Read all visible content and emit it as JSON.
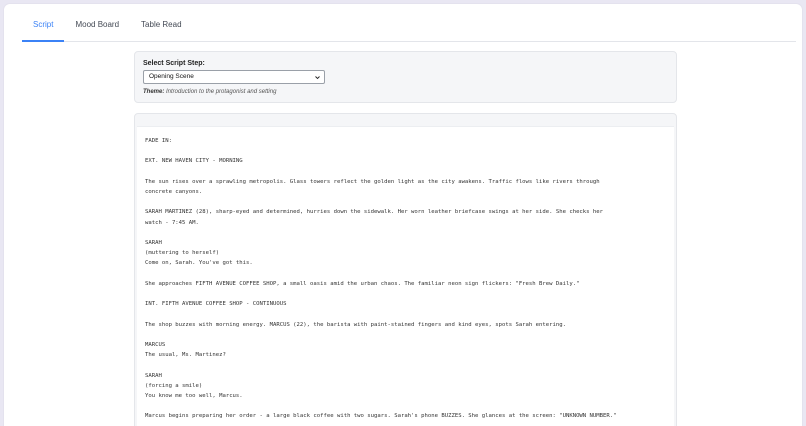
{
  "tabs": [
    {
      "label": "Script",
      "active": true
    },
    {
      "label": "Mood Board",
      "active": false
    },
    {
      "label": "Table Read",
      "active": false
    }
  ],
  "step_selector": {
    "label": "Select Script Step:",
    "selected": "Opening Scene",
    "theme_label": "Theme:",
    "theme_value": "Introduction to the protagonist and setting"
  },
  "script": {
    "lines": [
      "FADE IN:",
      "",
      "EXT. NEW HAVEN CITY - MORNING",
      "",
      "The sun rises over a sprawling metropolis. Glass towers reflect the golden light as the city awakens. Traffic flows like rivers through",
      "concrete canyons.",
      "",
      "SARAH MARTINEZ (28), sharp-eyed and determined, hurries down the sidewalk. Her worn leather briefcase swings at her side. She checks her",
      "watch - 7:45 AM.",
      "",
      "SARAH",
      "(muttering to herself)",
      "Come on, Sarah. You've got this.",
      "",
      "She approaches FIFTH AVENUE COFFEE SHOP, a small oasis amid the urban chaos. The familiar neon sign flickers: \"Fresh Brew Daily.\"",
      "",
      "INT. FIFTH AVENUE COFFEE SHOP - CONTINUOUS",
      "",
      "The shop buzzes with morning energy. MARCUS (22), the barista with paint-stained fingers and kind eyes, spots Sarah entering.",
      "",
      "MARCUS",
      "The usual, Ms. Martinez?",
      "",
      "SARAH",
      "(forcing a smile)",
      "You know me too well, Marcus.",
      "",
      "Marcus begins preparing her order - a large black coffee with two sugars. Sarah's phone BUZZES. She glances at the screen: \"UNKNOWN NUMBER.\""
    ]
  }
}
